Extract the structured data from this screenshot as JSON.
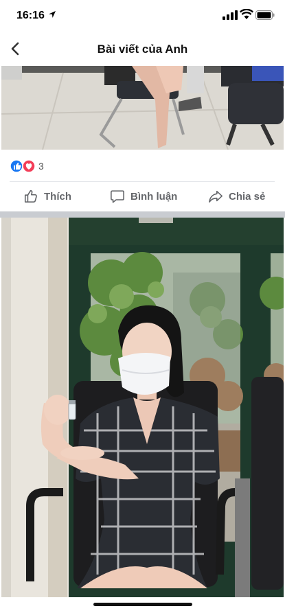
{
  "status_bar": {
    "time": "16:16"
  },
  "nav": {
    "title": "Bài viết của Anh"
  },
  "reactions": {
    "count": "3"
  },
  "actions": {
    "like": "Thích",
    "comment": "Bình luận",
    "share": "Chia sẻ"
  },
  "colors": {
    "like_blue": "#1877f2",
    "love_red": "#f33e58",
    "action_gray": "#65676b"
  },
  "icons": [
    "location-arrow-icon",
    "cell-signal-icon",
    "wifi-icon",
    "battery-icon",
    "back-chevron-icon",
    "like-reaction-icon",
    "love-reaction-icon",
    "thumbs-up-icon",
    "comment-bubble-icon",
    "share-arrow-icon"
  ]
}
